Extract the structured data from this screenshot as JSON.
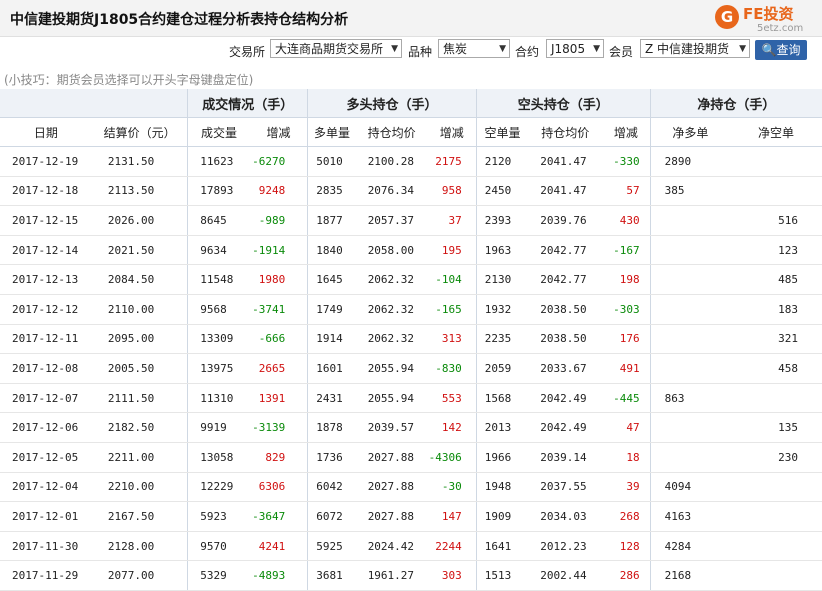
{
  "title": "中信建投期货J1805合约建仓过程分析表持仓结构分析",
  "logo": {
    "mark": "G",
    "brand": "FE投资",
    "site": "5etz.com",
    "brand_color": "#e8661b"
  },
  "filters": {
    "exchange_label": "交易所",
    "exchange_value": "大连商品期货交易所",
    "variety_label": "品种",
    "variety_value": "焦炭",
    "contract_label": "合约",
    "contract_value": "J1805",
    "member_label": "会员",
    "member_value": "Z 中信建投期货",
    "query_label": "查询",
    "query_icon": "search-icon"
  },
  "tip": "(小技巧：期货会员选择可以开头字母键盘定位)",
  "group_headers": [
    "成交情况（手）",
    "多头持仓（手）",
    "空头持仓（手）",
    "净持仓（手）"
  ],
  "columns": [
    "日期",
    "结算价（元）",
    "成交量",
    "增减",
    "多单量",
    "持仓均价",
    "增减",
    "空单量",
    "持仓均价",
    "增减",
    "净多单",
    "净空单"
  ],
  "colors": {
    "increase": "#d01010",
    "decrease": "#0a8a0a",
    "header_bg": "#eef2f7",
    "button": "#2f63a8"
  },
  "rows": [
    [
      "2017-12-19",
      "2131.50",
      "11623",
      "-6270",
      "5010",
      "2100.28",
      "2175",
      "2120",
      "2041.47",
      "-330",
      "2890",
      ""
    ],
    [
      "2017-12-18",
      "2113.50",
      "17893",
      "9248",
      "2835",
      "2076.34",
      "958",
      "2450",
      "2041.47",
      "57",
      "385",
      ""
    ],
    [
      "2017-12-15",
      "2026.00",
      "8645",
      "-989",
      "1877",
      "2057.37",
      "37",
      "2393",
      "2039.76",
      "430",
      "",
      "516"
    ],
    [
      "2017-12-14",
      "2021.50",
      "9634",
      "-1914",
      "1840",
      "2058.00",
      "195",
      "1963",
      "2042.77",
      "-167",
      "",
      "123"
    ],
    [
      "2017-12-13",
      "2084.50",
      "11548",
      "1980",
      "1645",
      "2062.32",
      "-104",
      "2130",
      "2042.77",
      "198",
      "",
      "485"
    ],
    [
      "2017-12-12",
      "2110.00",
      "9568",
      "-3741",
      "1749",
      "2062.32",
      "-165",
      "1932",
      "2038.50",
      "-303",
      "",
      "183"
    ],
    [
      "2017-12-11",
      "2095.00",
      "13309",
      "-666",
      "1914",
      "2062.32",
      "313",
      "2235",
      "2038.50",
      "176",
      "",
      "321"
    ],
    [
      "2017-12-08",
      "2005.50",
      "13975",
      "2665",
      "1601",
      "2055.94",
      "-830",
      "2059",
      "2033.67",
      "491",
      "",
      "458"
    ],
    [
      "2017-12-07",
      "2111.50",
      "11310",
      "1391",
      "2431",
      "2055.94",
      "553",
      "1568",
      "2042.49",
      "-445",
      "863",
      ""
    ],
    [
      "2017-12-06",
      "2182.50",
      "9919",
      "-3139",
      "1878",
      "2039.57",
      "142",
      "2013",
      "2042.49",
      "47",
      "",
      "135"
    ],
    [
      "2017-12-05",
      "2211.00",
      "13058",
      "829",
      "1736",
      "2027.88",
      "-4306",
      "1966",
      "2039.14",
      "18",
      "",
      "230"
    ],
    [
      "2017-12-04",
      "2210.00",
      "12229",
      "6306",
      "6042",
      "2027.88",
      "-30",
      "1948",
      "2037.55",
      "39",
      "4094",
      ""
    ],
    [
      "2017-12-01",
      "2167.50",
      "5923",
      "-3647",
      "6072",
      "2027.88",
      "147",
      "1909",
      "2034.03",
      "268",
      "4163",
      ""
    ],
    [
      "2017-11-30",
      "2128.00",
      "9570",
      "4241",
      "5925",
      "2024.42",
      "2244",
      "1641",
      "2012.23",
      "128",
      "4284",
      ""
    ],
    [
      "2017-11-29",
      "2077.00",
      "5329",
      "-4893",
      "3681",
      "1961.27",
      "303",
      "1513",
      "2002.44",
      "286",
      "2168",
      ""
    ]
  ]
}
